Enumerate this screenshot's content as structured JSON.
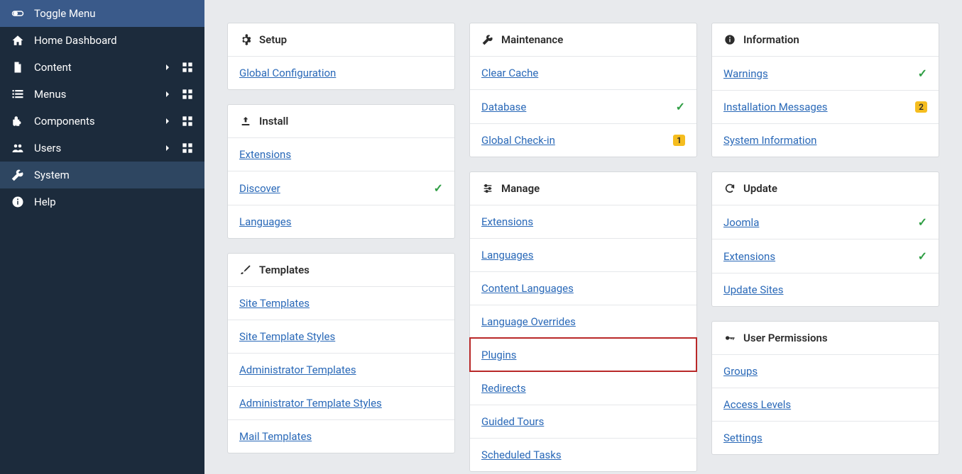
{
  "sidebar": {
    "toggle": "Toggle Menu",
    "items": [
      {
        "label": "Home Dashboard"
      },
      {
        "label": "Content"
      },
      {
        "label": "Menus"
      },
      {
        "label": "Components"
      },
      {
        "label": "Users"
      },
      {
        "label": "System"
      },
      {
        "label": "Help"
      }
    ]
  },
  "cards": {
    "setup": {
      "title": "Setup",
      "links": {
        "global_config": "Global Configuration"
      }
    },
    "install": {
      "title": "Install",
      "links": {
        "extensions": "Extensions",
        "discover": "Discover",
        "languages": "Languages"
      }
    },
    "templates": {
      "title": "Templates",
      "links": {
        "site_templates": "Site Templates",
        "site_template_styles": "Site Template Styles",
        "admin_templates": "Administrator Templates",
        "admin_template_styles": "Administrator Template Styles",
        "mail_templates": "Mail Templates"
      }
    },
    "maintenance": {
      "title": "Maintenance",
      "links": {
        "clear_cache": "Clear Cache",
        "database": "Database",
        "global_checkin": "Global Check-in"
      },
      "badge_checkin": "1"
    },
    "manage": {
      "title": "Manage",
      "links": {
        "extensions": "Extensions",
        "languages": "Languages",
        "content_languages": "Content Languages",
        "language_overrides": "Language Overrides",
        "plugins": "Plugins",
        "redirects": "Redirects",
        "guided_tours": "Guided Tours",
        "scheduled_tasks": "Scheduled Tasks"
      }
    },
    "information": {
      "title": "Information",
      "links": {
        "warnings": "Warnings",
        "install_messages": "Installation Messages",
        "sysinfo": "System Information"
      },
      "badge_install": "2"
    },
    "update": {
      "title": "Update",
      "links": {
        "joomla": "Joomla",
        "extensions": "Extensions",
        "update_sites": "Update Sites"
      }
    },
    "user_permissions": {
      "title": "User Permissions",
      "links": {
        "groups": "Groups",
        "access_levels": "Access Levels",
        "settings": "Settings"
      }
    }
  }
}
